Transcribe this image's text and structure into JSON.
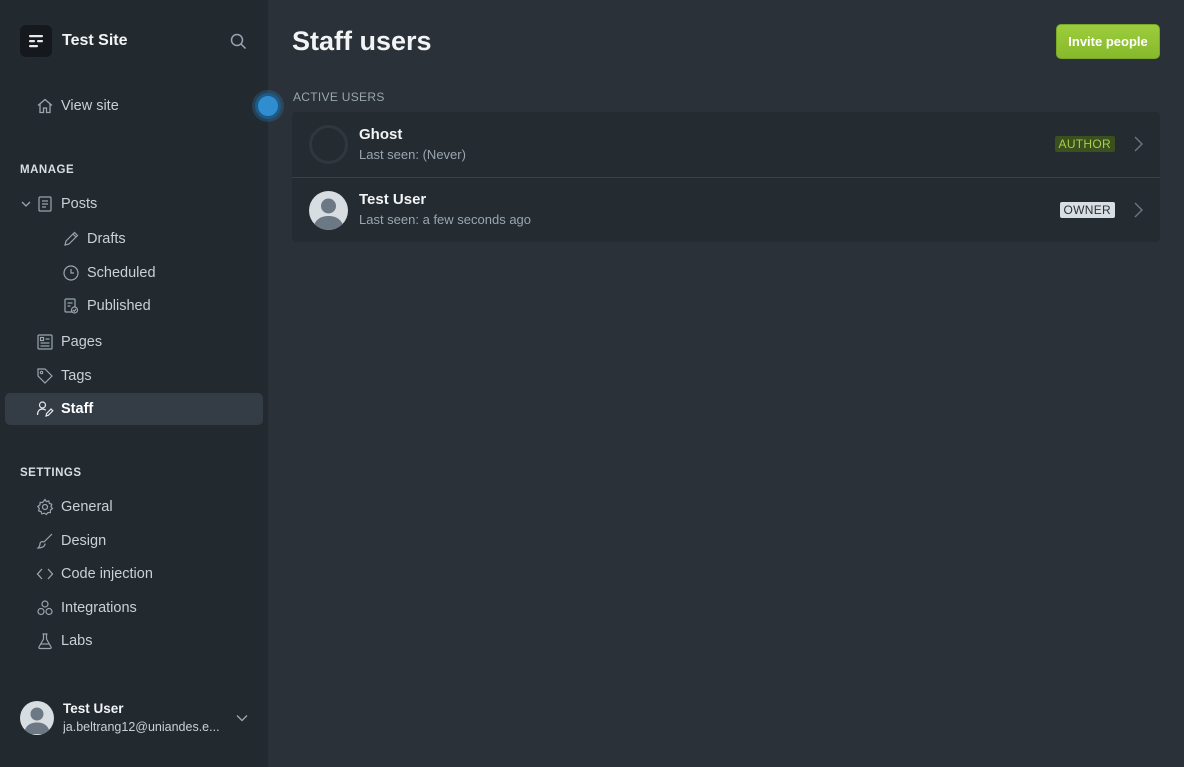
{
  "site": {
    "title": "Test Site"
  },
  "nav": {
    "view_site": "View site",
    "manage_label": "MANAGE",
    "posts": "Posts",
    "drafts": "Drafts",
    "scheduled": "Scheduled",
    "published": "Published",
    "pages": "Pages",
    "tags": "Tags",
    "staff": "Staff",
    "settings_label": "SETTINGS",
    "general": "General",
    "design": "Design",
    "code_injection": "Code injection",
    "integrations": "Integrations",
    "labs": "Labs"
  },
  "current_user": {
    "name": "Test User",
    "email": "ja.beltrang12@uniandes.e..."
  },
  "main": {
    "title": "Staff users",
    "invite_label": "Invite people",
    "group_label": "ACTIVE USERS",
    "users": [
      {
        "name": "Ghost",
        "last_seen": "Last seen: (Never)",
        "role": "AUTHOR"
      },
      {
        "name": "Test User",
        "last_seen": "Last seen: a few seconds ago",
        "role": "OWNER"
      }
    ]
  },
  "colors": {
    "accent": "#9ccd3c",
    "sidebar_bg": "#22292f",
    "main_bg": "#2a3138",
    "active_bg": "#343d46",
    "update_dot": "#2f8dd0"
  },
  "icons": [
    "menu-logo-icon",
    "search-icon",
    "home-icon",
    "chevron-down-icon",
    "posts-icon",
    "pencil-icon",
    "clock-icon",
    "published-icon",
    "pages-icon",
    "tag-icon",
    "staff-icon",
    "gear-icon",
    "brush-icon",
    "code-icon",
    "integrations-icon",
    "flask-icon",
    "chevron-right-icon"
  ]
}
